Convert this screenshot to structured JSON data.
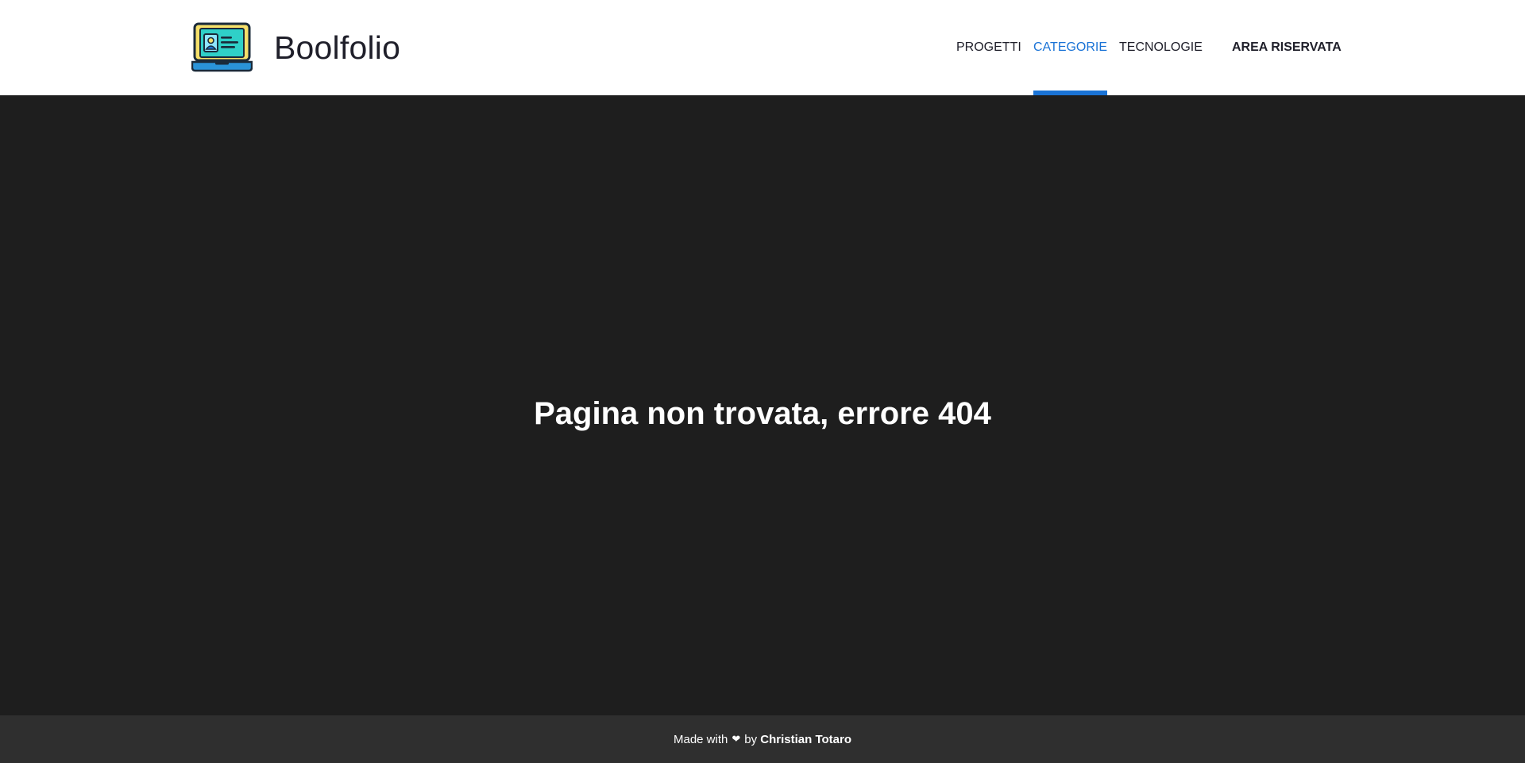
{
  "header": {
    "brand_name": "Boolfolio",
    "logo_icon": "laptop-id-card-icon",
    "nav": {
      "projects": "PROGETTI",
      "categories": "CATEGORIE",
      "technologies": "TECNOLOGIE",
      "reserved_area": "AREA RISERVATA",
      "active": "categories"
    }
  },
  "main": {
    "title": "Pagina non trovata, errore 404"
  },
  "footer": {
    "made_with": "Made with",
    "heart_icon": "heart-icon",
    "by": "by",
    "author": "Christian Totaro"
  },
  "colors": {
    "accent": "#1a73d6",
    "page_bg": "#1e1e1e",
    "footer_bg": "#2f2f2f",
    "header_bg": "#ffffff"
  }
}
